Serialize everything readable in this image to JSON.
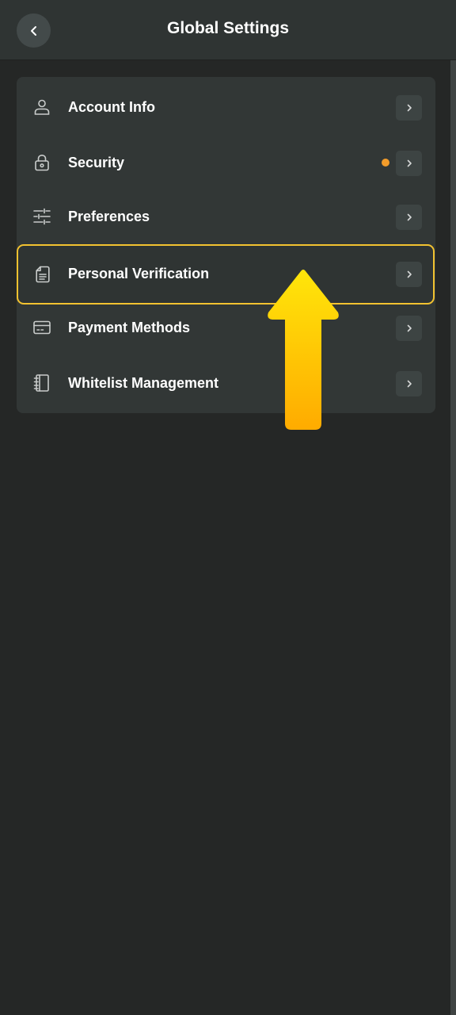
{
  "header": {
    "title": "Global Settings",
    "back_icon": "chevron-left-icon"
  },
  "menu": {
    "items": [
      {
        "label": "Account Info",
        "icon": "user-icon",
        "badge": false
      },
      {
        "label": "Security",
        "icon": "lock-icon",
        "badge": true,
        "badge_color": "#f39c2a"
      },
      {
        "label": "Preferences",
        "icon": "sliders-icon",
        "badge": false
      },
      {
        "label": "Personal Verification",
        "icon": "document-icon",
        "badge": false,
        "highlighted": true
      },
      {
        "label": "Payment Methods",
        "icon": "credit-card-icon",
        "badge": false
      },
      {
        "label": "Whitelist Management",
        "icon": "notebook-icon",
        "badge": false
      }
    ]
  },
  "colors": {
    "background": "#252726",
    "card": "#323736",
    "highlight_border": "#f2c230",
    "arrow_top": "#ffe60a",
    "arrow_bottom": "#ffab00"
  },
  "annotation": {
    "arrow_icon": "up-arrow-icon"
  }
}
